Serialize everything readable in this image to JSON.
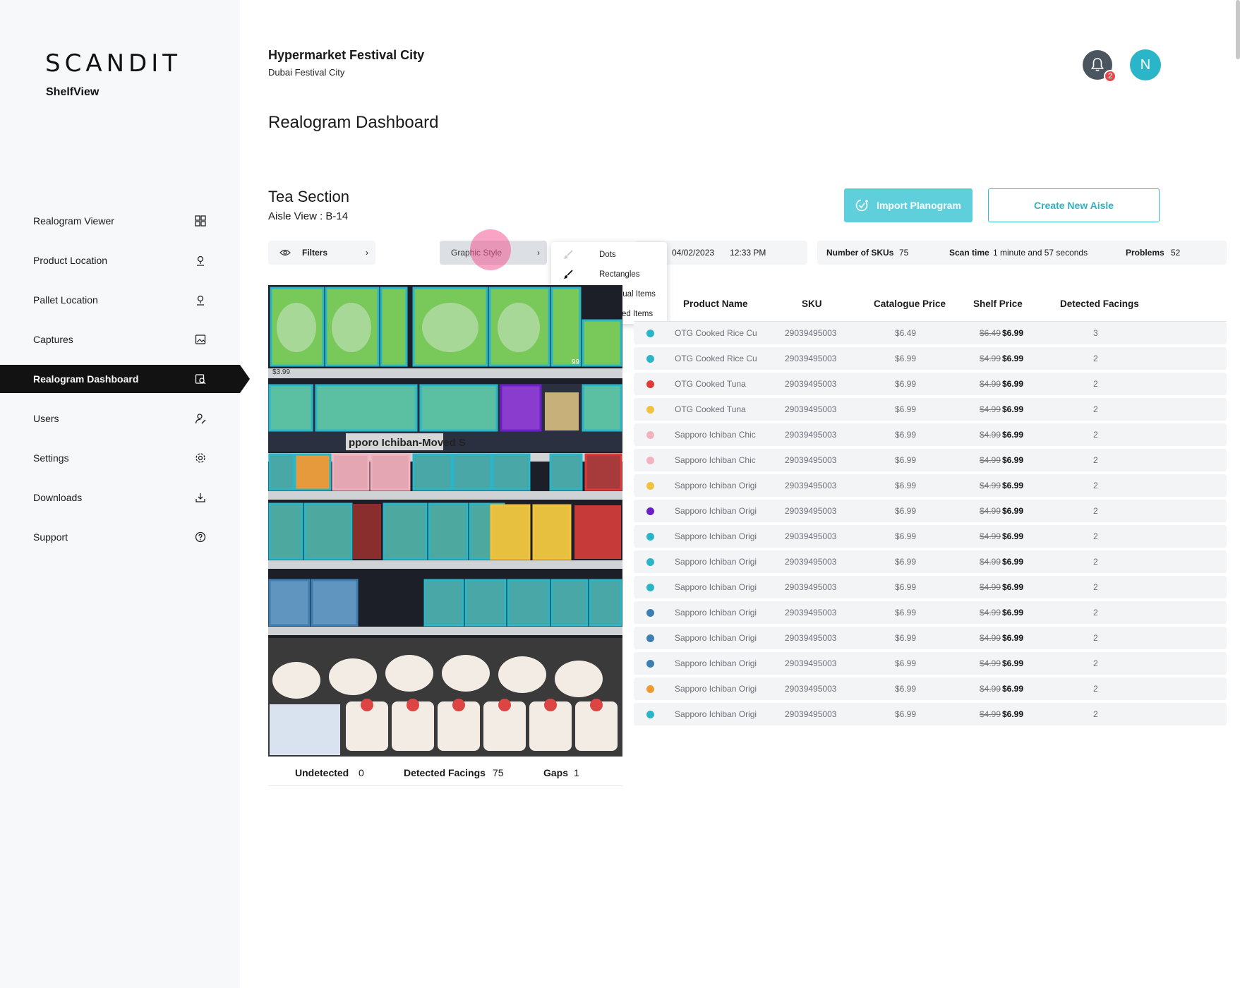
{
  "app": {
    "logo": "SCANDIT",
    "product": "ShelfView"
  },
  "sidebar": {
    "items": [
      {
        "label": "Realogram Viewer",
        "icon": "grid-icon",
        "active": false
      },
      {
        "label": "Product Location",
        "icon": "location-pin-icon",
        "active": false
      },
      {
        "label": "Pallet Location",
        "icon": "location-pin-icon",
        "active": false
      },
      {
        "label": "Captures",
        "icon": "image-icon",
        "active": false
      },
      {
        "label": "Realogram Dashboard",
        "icon": "search-doc-icon",
        "active": true
      },
      {
        "label": "Users",
        "icon": "user-edit-icon",
        "active": false
      },
      {
        "label": "Settings",
        "icon": "gear-icon",
        "active": false
      },
      {
        "label": "Downloads",
        "icon": "download-icon",
        "active": false
      },
      {
        "label": "Support",
        "icon": "help-icon",
        "active": false
      }
    ]
  },
  "header": {
    "store_name": "Hypermarket Festival City",
    "store_location": "Dubai Festival City",
    "notifications": "2",
    "avatar_initial": "N"
  },
  "page": {
    "title": "Realogram Dashboard",
    "section_title": "Tea Section",
    "aisle_view": "Aisle View : B-14"
  },
  "actions": {
    "import_label": "Import Planogram",
    "create_label": "Create New Aisle"
  },
  "toolbar": {
    "filters_label": "Filters",
    "graphic_style_label": "Graphic Style",
    "dropdown": [
      {
        "label": "Dots",
        "selected": false
      },
      {
        "label": "Rectangles",
        "selected": true
      },
      {
        "label": "Individual Items",
        "selected": false
      },
      {
        "label": "Grouped Items",
        "selected": true
      }
    ],
    "date": "04/02/2023",
    "time": "12:33 PM",
    "skus_label": "Number of SKUs",
    "skus_value": "75",
    "scan_label": "Scan time",
    "scan_value": "1 minute and 57 seconds",
    "problems_label": "Problems",
    "problems_value": "52"
  },
  "shelf_image": {
    "overlay_label": "pporo Ichiban-Moved S",
    "price_tag_1": "$3.99",
    "price_tag_2": "99"
  },
  "shelf_footer": {
    "undetected_label": "Undetected",
    "undetected_value": "0",
    "facings_label": "Detected Facings",
    "facings_value": "75",
    "gaps_label": "Gaps",
    "gaps_value": "1"
  },
  "table": {
    "headers": [
      "Product Name",
      "SKU",
      "Catalogue Price",
      "Shelf Price",
      "Detected Facings"
    ],
    "rows": [
      {
        "color": "#2bb5c8",
        "name": "OTG Cooked Rice Cu",
        "sku": "29039495003",
        "catalogue": "$6.49",
        "old": "$6.49",
        "shelf": "$6.99",
        "facings": "3"
      },
      {
        "color": "#2bb5c8",
        "name": "OTG Cooked Rice Cu",
        "sku": "29039495003",
        "catalogue": "$6.99",
        "old": "$4.99",
        "shelf": "$6.99",
        "facings": "2"
      },
      {
        "color": "#e03a3a",
        "name": "OTG Cooked Tuna",
        "sku": "29039495003",
        "catalogue": "$6.99",
        "old": "$4.99",
        "shelf": "$6.99",
        "facings": "2"
      },
      {
        "color": "#f0c23e",
        "name": "OTG Cooked Tuna",
        "sku": "29039495003",
        "catalogue": "$6.99",
        "old": "$4.99",
        "shelf": "$6.99",
        "facings": "2"
      },
      {
        "color": "#f2b3bf",
        "name": "Sapporo Ichiban Chic",
        "sku": "29039495003",
        "catalogue": "$6.99",
        "old": "$4.99",
        "shelf": "$6.99",
        "facings": "2"
      },
      {
        "color": "#f2b3bf",
        "name": "Sapporo Ichiban Chic",
        "sku": "29039495003",
        "catalogue": "$6.99",
        "old": "$4.99",
        "shelf": "$6.99",
        "facings": "2"
      },
      {
        "color": "#f0c23e",
        "name": "Sapporo Ichiban Origi",
        "sku": "29039495003",
        "catalogue": "$6.99",
        "old": "$4.99",
        "shelf": "$6.99",
        "facings": "2"
      },
      {
        "color": "#6b1fc7",
        "name": "Sapporo Ichiban Origi",
        "sku": "29039495003",
        "catalogue": "$6.99",
        "old": "$4.99",
        "shelf": "$6.99",
        "facings": "2"
      },
      {
        "color": "#2bb5c8",
        "name": "Sapporo Ichiban Origi",
        "sku": "29039495003",
        "catalogue": "$6.99",
        "old": "$4.99",
        "shelf": "$6.99",
        "facings": "2"
      },
      {
        "color": "#2bb5c8",
        "name": "Sapporo Ichiban Origi",
        "sku": "29039495003",
        "catalogue": "$6.99",
        "old": "$4.99",
        "shelf": "$6.99",
        "facings": "2"
      },
      {
        "color": "#2bb5c8",
        "name": "Sapporo Ichiban Origi",
        "sku": "29039495003",
        "catalogue": "$6.99",
        "old": "$4.99",
        "shelf": "$6.99",
        "facings": "2"
      },
      {
        "color": "#3d7fb3",
        "name": "Sapporo Ichiban Origi",
        "sku": "29039495003",
        "catalogue": "$6.99",
        "old": "$4.99",
        "shelf": "$6.99",
        "facings": "2"
      },
      {
        "color": "#3d7fb3",
        "name": "Sapporo Ichiban Origi",
        "sku": "29039495003",
        "catalogue": "$6.99",
        "old": "$4.99",
        "shelf": "$6.99",
        "facings": "2"
      },
      {
        "color": "#3d7fb3",
        "name": "Sapporo Ichiban Origi",
        "sku": "29039495003",
        "catalogue": "$6.99",
        "old": "$4.99",
        "shelf": "$6.99",
        "facings": "2"
      },
      {
        "color": "#ef9a2e",
        "name": "Sapporo Ichiban Origi",
        "sku": "29039495003",
        "catalogue": "$6.99",
        "old": "$4.99",
        "shelf": "$6.99",
        "facings": "2"
      },
      {
        "color": "#2bb5c8",
        "name": "Sapporo Ichiban Origi",
        "sku": "29039495003",
        "catalogue": "$6.99",
        "old": "$4.99",
        "shelf": "$6.99",
        "facings": "2"
      }
    ]
  }
}
